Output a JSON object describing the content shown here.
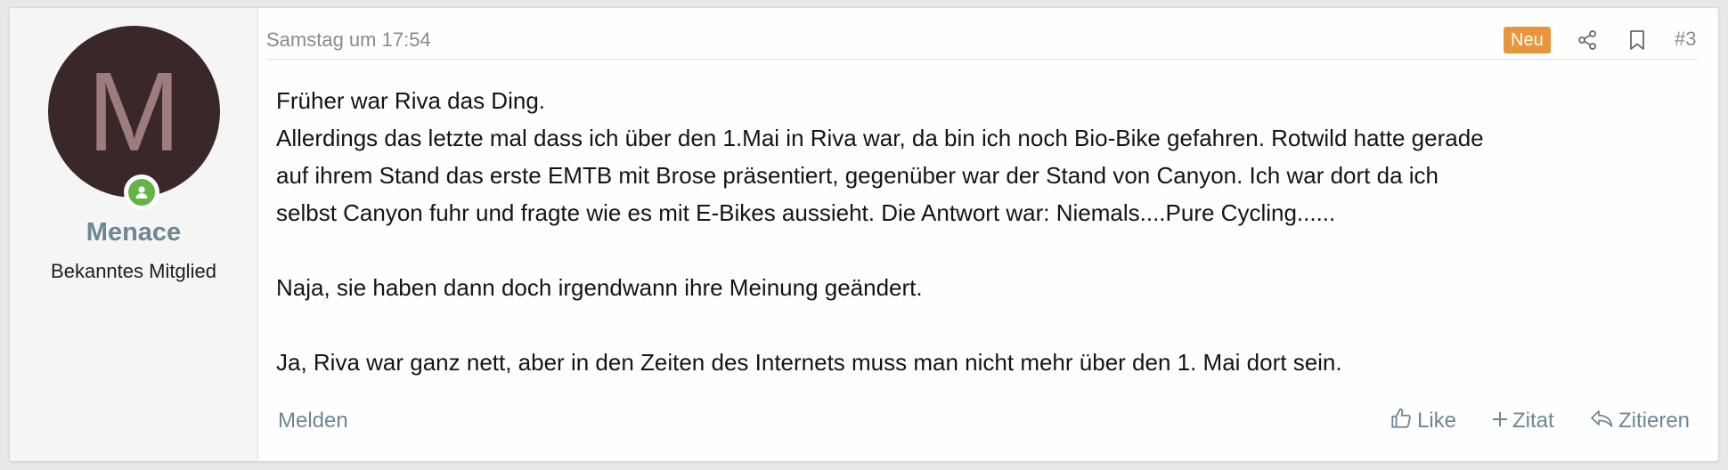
{
  "user": {
    "avatar_letter": "M",
    "name": "Menace",
    "title": "Bekanntes Mitglied",
    "online": true
  },
  "post": {
    "date": "Samstag um 17:54",
    "new_label": "Neu",
    "number": "#3",
    "body": [
      "Früher war Riva das Ding.",
      "Allerdings das letzte mal dass ich über den 1.Mai in Riva war, da bin ich noch Bio-Bike gefahren. Rotwild hatte gerade",
      "auf ihrem Stand das erste EMTB mit Brose präsentiert, gegenüber war der Stand von Canyon. Ich war dort da ich",
      "selbst Canyon fuhr und fragte wie es mit E-Bikes aussieht. Die Antwort war: Niemals....Pure Cycling......",
      "",
      "Naja, sie haben dann doch irgendwann ihre Meinung geändert.",
      "",
      "Ja, Riva war ganz nett, aber in den Zeiten des Internets muss man nicht mehr über den 1. Mai dort sein."
    ]
  },
  "footer": {
    "report": "Melden",
    "like": "Like",
    "quote": "Zitat",
    "reply": "Zitieren"
  },
  "colors": {
    "avatar_bg": "#3a2728",
    "avatar_letter": "#9c7c7f",
    "online": "#63b546",
    "link": "#6d8795",
    "new_badge": "#e8953b"
  }
}
